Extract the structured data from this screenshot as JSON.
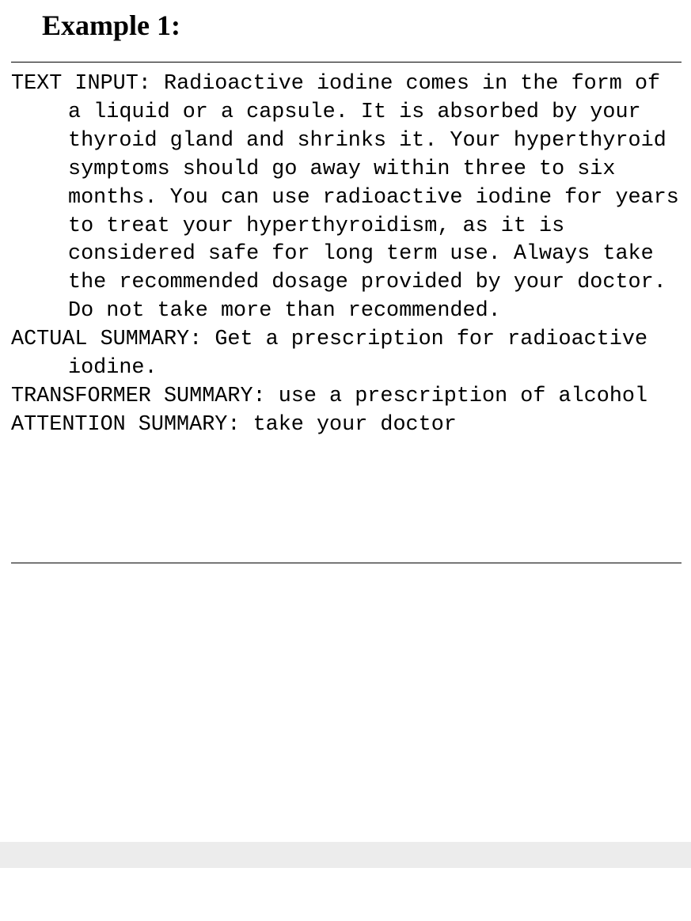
{
  "heading": "Example 1:",
  "entries": [
    {
      "label": "TEXT INPUT:",
      "text": "Radioactive iodine comes in the form of a liquid or a capsule. It is absorbed by your thyroid gland and shrinks it. Your hyperthyroid symptoms should go away within three to six months. You can use radioactive iodine for years to treat your hyperthyroidism, as it is considered safe for long term use. Always take the recommended dosage provided by your doctor. Do not take more than recommended."
    },
    {
      "label": "ACTUAL SUMMARY:",
      "text": "Get a prescription for radioactive iodine."
    },
    {
      "label": "TRANSFORMER SUMMARY:",
      "text": "use a prescription of alcohol"
    },
    {
      "label": "ATTENTION SUMMARY:",
      "text": "take your doctor"
    }
  ]
}
